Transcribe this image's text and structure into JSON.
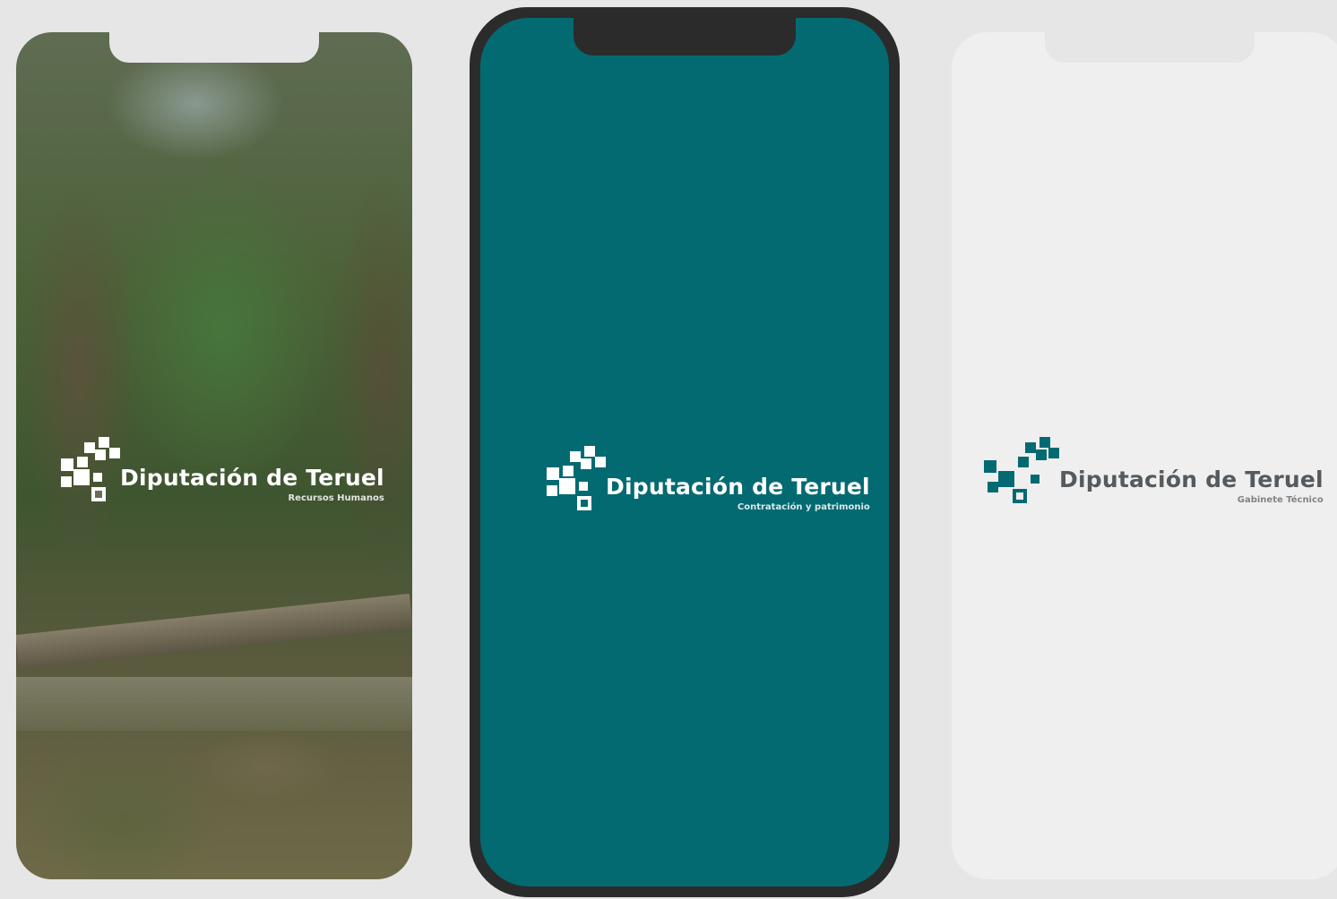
{
  "phones": [
    {
      "id": "photo",
      "background": "forest-canyon-photo",
      "logo": {
        "title": "Diputación de Teruel",
        "subtitle": "Recursos Humanos",
        "color": "#ffffff"
      }
    },
    {
      "id": "teal",
      "background": "#046a72",
      "frame_color": "#2b2b2b",
      "logo": {
        "title": "Diputación de Teruel",
        "subtitle": "Contratación y patrimonio",
        "color": "#ffffff"
      }
    },
    {
      "id": "light",
      "background": "#efefef",
      "logo": {
        "title": "Diputación de Teruel",
        "subtitle": "Gabinete Técnico",
        "color": "#555a5e",
        "mark_color": "#046a72"
      }
    }
  ]
}
